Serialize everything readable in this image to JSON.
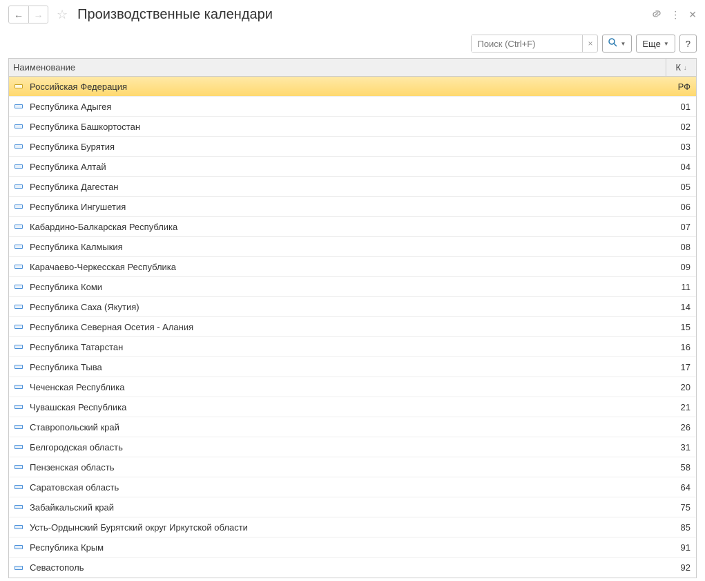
{
  "header": {
    "title": "Производственные календари"
  },
  "toolbar": {
    "search_placeholder": "Поиск (Ctrl+F)",
    "more_label": "Еще",
    "help_label": "?"
  },
  "table": {
    "col_name": "Наименование",
    "col_code": "К",
    "rows": [
      {
        "name": "Российская Федерация",
        "code": "РФ",
        "selected": true
      },
      {
        "name": "Республика Адыгея",
        "code": "01"
      },
      {
        "name": "Республика Башкортостан",
        "code": "02"
      },
      {
        "name": "Республика Бурятия",
        "code": "03"
      },
      {
        "name": "Республика Алтай",
        "code": "04"
      },
      {
        "name": "Республика Дагестан",
        "code": "05"
      },
      {
        "name": "Республика Ингушетия",
        "code": "06"
      },
      {
        "name": "Кабардино-Балкарская Республика",
        "code": "07"
      },
      {
        "name": "Республика Калмыкия",
        "code": "08"
      },
      {
        "name": "Карачаево-Черкесская Республика",
        "code": "09"
      },
      {
        "name": "Республика Коми",
        "code": "11"
      },
      {
        "name": "Республика Саха (Якутия)",
        "code": "14"
      },
      {
        "name": "Республика Северная Осетия - Алания",
        "code": "15"
      },
      {
        "name": "Республика Татарстан",
        "code": "16"
      },
      {
        "name": "Республика Тыва",
        "code": "17"
      },
      {
        "name": "Чеченская Республика",
        "code": "20"
      },
      {
        "name": "Чувашская Республика",
        "code": "21"
      },
      {
        "name": "Ставропольский край",
        "code": "26"
      },
      {
        "name": "Белгородская область",
        "code": "31"
      },
      {
        "name": "Пензенская область",
        "code": "58"
      },
      {
        "name": "Саратовская область",
        "code": "64"
      },
      {
        "name": "Забайкальский край",
        "code": "75"
      },
      {
        "name": "Усть-Ордынский Бурятский округ Иркутской области",
        "code": "85"
      },
      {
        "name": "Республика Крым",
        "code": "91"
      },
      {
        "name": "Севастополь",
        "code": "92"
      }
    ]
  }
}
